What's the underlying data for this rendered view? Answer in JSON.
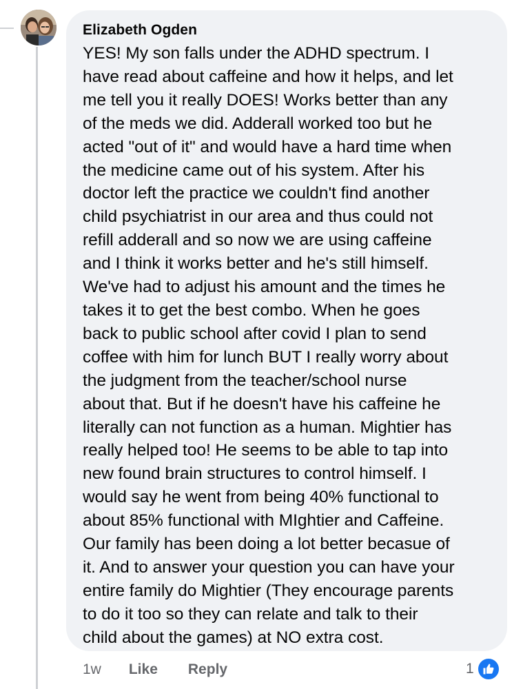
{
  "comment": {
    "author": "Elizabeth Ogden",
    "text": "YES! My son falls under the ADHD spectrum. I\nhave read about caffeine and how it helps, and let\nme tell you it really DOES! Works better than any\nof the meds we did. Adderall worked too but he\nacted \"out of it\" and would have a hard time when\nthe medicine came out of his system. After his\ndoctor left the practice we couldn't find another\nchild psychiatrist in our area and thus could not\nrefill adderall and so now we are using caffeine\nand I think it works better and he's still himself.\nWe've had to adjust his amount and the times he\ntakes it to get the best combo. When he goes\nback to public school after covid I plan to send\ncoffee with him for lunch BUT I really worry about\nthe judgment from the teacher/school nurse\nabout that. But if he doesn't have his caffeine he\nliterally can not function as a human. Mightier has\nreally helped too! He seems to be able to tap into\nnew found brain structures to control himself. I\nwould say he went from being 40% functional to\nabout 85% functional with MIghtier and Caffeine.\nOur family has been doing a lot better becasue of\nit. And to answer your question you can have your\nentire family do Mightier (They encourage parents\nto do it too so they can relate and talk to their\nchild about the games) at NO extra cost."
  },
  "actions": {
    "timestamp": "1w",
    "like_label": "Like",
    "reply_label": "Reply"
  },
  "reactions": {
    "count": "1",
    "icon": "like-icon",
    "color": "#1877f2"
  },
  "colors": {
    "bubble": "#f0f2f5",
    "text": "#050505",
    "secondary_text": "#65676b",
    "thread_line": "#ced0d4"
  }
}
